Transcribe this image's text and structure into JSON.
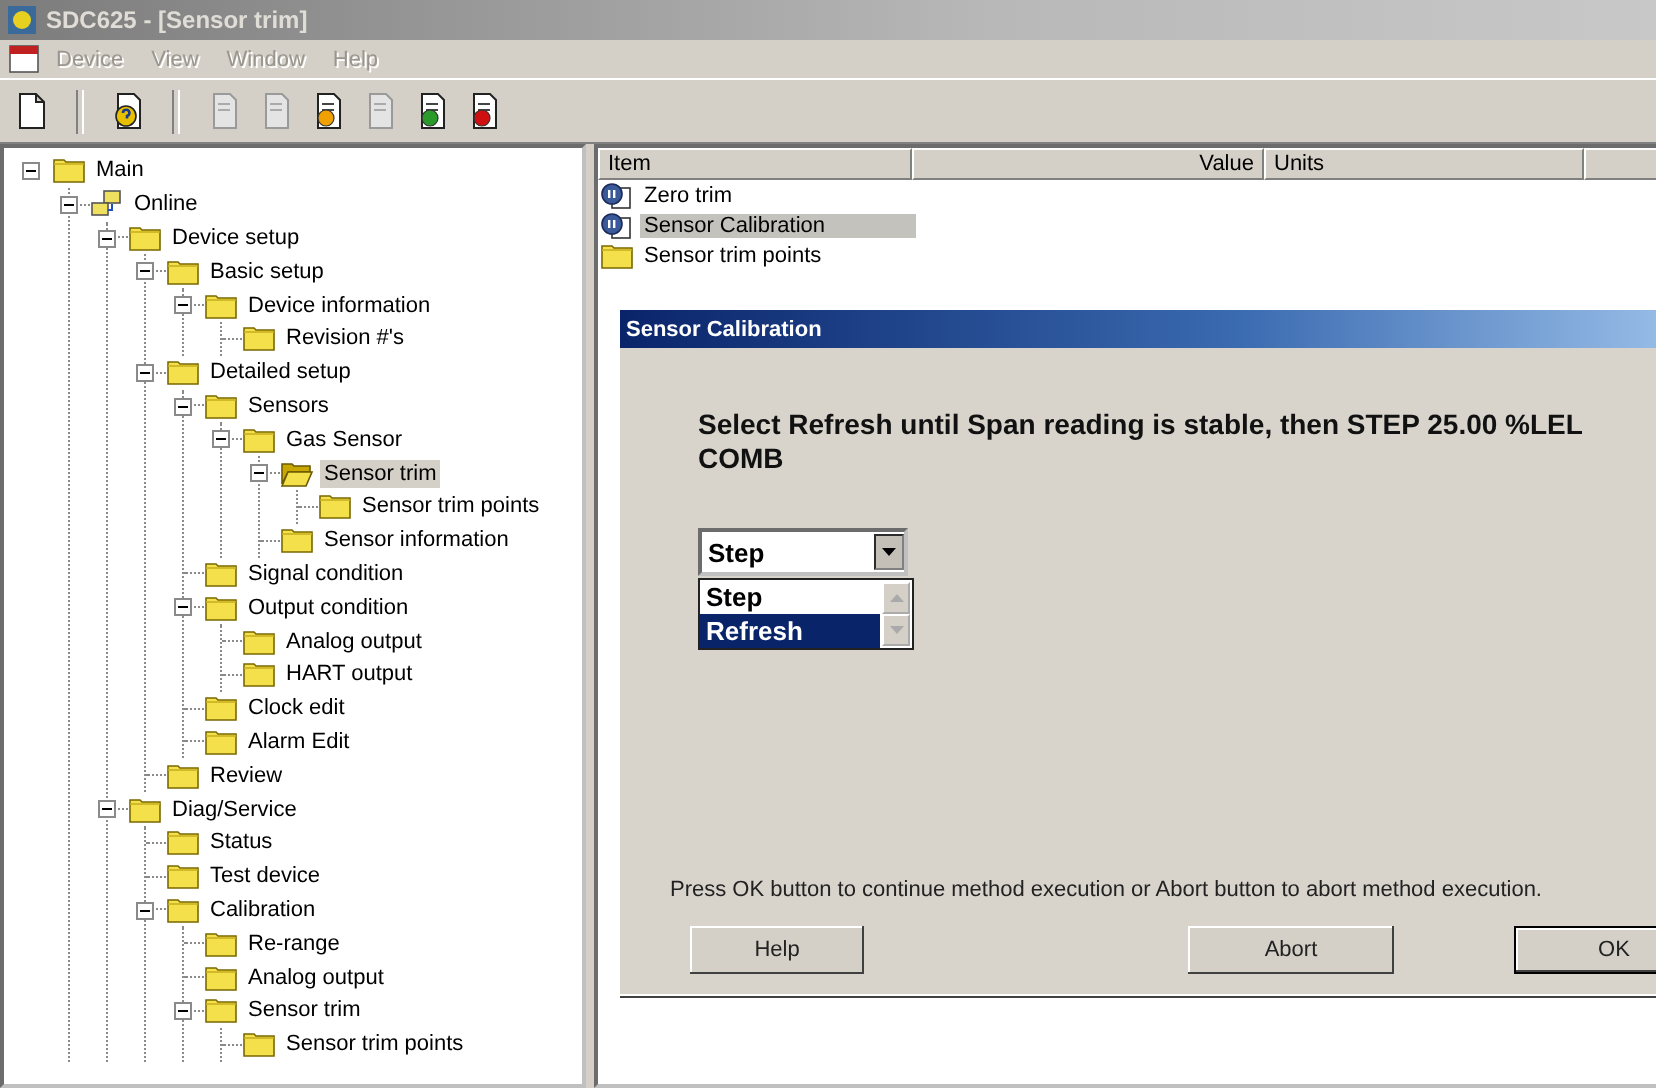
{
  "window": {
    "title": "SDC625 - [Sensor trim]"
  },
  "menu": [
    {
      "label": "Device",
      "disabled": true
    },
    {
      "label": "View",
      "disabled": true
    },
    {
      "label": "Window",
      "disabled": true
    },
    {
      "label": "Help",
      "disabled": true
    }
  ],
  "toolbar": {
    "groups": [
      {
        "items": [
          {
            "kind": "new",
            "disabled": false
          }
        ]
      },
      {
        "items": [
          {
            "kind": "help",
            "disabled": false
          }
        ]
      },
      {
        "items": [
          {
            "kind": "doc",
            "disabled": true
          },
          {
            "kind": "doc",
            "disabled": true
          },
          {
            "kind": "doc-upload",
            "disabled": false
          },
          {
            "kind": "doc",
            "disabled": true
          },
          {
            "kind": "doc-user",
            "disabled": false
          },
          {
            "kind": "doc-stop",
            "disabled": false
          }
        ]
      }
    ]
  },
  "tree": [
    {
      "label": "Main",
      "kind": "folder",
      "selected": false,
      "expanded": true,
      "children": [
        {
          "label": "Online",
          "kind": "connection",
          "selected": false,
          "expanded": true,
          "children": [
            {
              "label": "Device setup",
              "kind": "folder",
              "selected": false,
              "expanded": true,
              "children": [
                {
                  "label": "Basic setup",
                  "kind": "folder",
                  "selected": false,
                  "expanded": true,
                  "children": [
                    {
                      "label": "Device information",
                      "kind": "folder",
                      "selected": false,
                      "expanded": true,
                      "children": [
                        {
                          "label": "Revision #'s",
                          "kind": "folder",
                          "selected": false
                        }
                      ]
                    }
                  ]
                },
                {
                  "label": "Detailed setup",
                  "kind": "folder",
                  "selected": false,
                  "expanded": true,
                  "children": [
                    {
                      "label": "Sensors",
                      "kind": "folder",
                      "selected": false,
                      "expanded": true,
                      "children": [
                        {
                          "label": "Gas Sensor",
                          "kind": "folder",
                          "selected": false,
                          "expanded": true,
                          "children": [
                            {
                              "label": "Sensor trim",
                              "kind": "folder",
                              "selected": true,
                              "expanded": true,
                              "children": [
                                {
                                  "label": "Sensor trim points",
                                  "kind": "folder",
                                  "selected": false
                                }
                              ]
                            },
                            {
                              "label": "Sensor information",
                              "kind": "folder",
                              "selected": false
                            }
                          ]
                        }
                      ]
                    },
                    {
                      "label": "Signal condition",
                      "kind": "folder",
                      "selected": false
                    },
                    {
                      "label": "Output condition",
                      "kind": "folder",
                      "selected": false,
                      "expanded": true,
                      "children": [
                        {
                          "label": "Analog output",
                          "kind": "folder",
                          "selected": false
                        },
                        {
                          "label": "HART output",
                          "kind": "folder",
                          "selected": false
                        }
                      ]
                    },
                    {
                      "label": "Clock edit",
                      "kind": "folder",
                      "selected": false
                    },
                    {
                      "label": "Alarm Edit",
                      "kind": "folder",
                      "selected": false
                    }
                  ]
                },
                {
                  "label": "Review",
                  "kind": "folder",
                  "selected": false
                }
              ]
            },
            {
              "label": "Diag/Service",
              "kind": "folder",
              "selected": false,
              "expanded": true,
              "children": [
                {
                  "label": "Status",
                  "kind": "folder",
                  "selected": false
                },
                {
                  "label": "Test device",
                  "kind": "folder",
                  "selected": false
                },
                {
                  "label": "Calibration",
                  "kind": "folder",
                  "selected": false,
                  "expanded": true,
                  "children": [
                    {
                      "label": "Re-range",
                      "kind": "folder",
                      "selected": false
                    },
                    {
                      "label": "Analog output",
                      "kind": "folder",
                      "selected": false
                    },
                    {
                      "label": "Sensor trim",
                      "kind": "folder",
                      "selected": false,
                      "expanded": true,
                      "children": [
                        {
                          "label": "Sensor trim points",
                          "kind": "folder",
                          "selected": false
                        }
                      ]
                    }
                  ]
                }
              ]
            }
          ]
        }
      ]
    }
  ],
  "list": {
    "columns": [
      "Item",
      "Value",
      "Units"
    ],
    "rows": [
      {
        "label": "Zero trim",
        "kind": "method",
        "selected": false
      },
      {
        "label": "Sensor Calibration",
        "kind": "method",
        "selected": true
      },
      {
        "label": "Sensor trim points",
        "kind": "folder",
        "selected": false
      }
    ]
  },
  "dialog": {
    "title": "Sensor Calibration",
    "message": "Select Refresh until Span reading is stable, then STEP 25.00 %LEL COMB",
    "combo": {
      "value": "Step",
      "expanded": true,
      "options": [
        {
          "label": "Step",
          "highlighted": false
        },
        {
          "label": "Refresh",
          "highlighted": true
        }
      ]
    },
    "note": "Press OK button to continue method execution or Abort button to abort method execution.",
    "buttons": [
      {
        "label": "Help",
        "default": false
      },
      {
        "label": "Abort",
        "default": false
      },
      {
        "label": "OK",
        "default": true
      }
    ]
  }
}
